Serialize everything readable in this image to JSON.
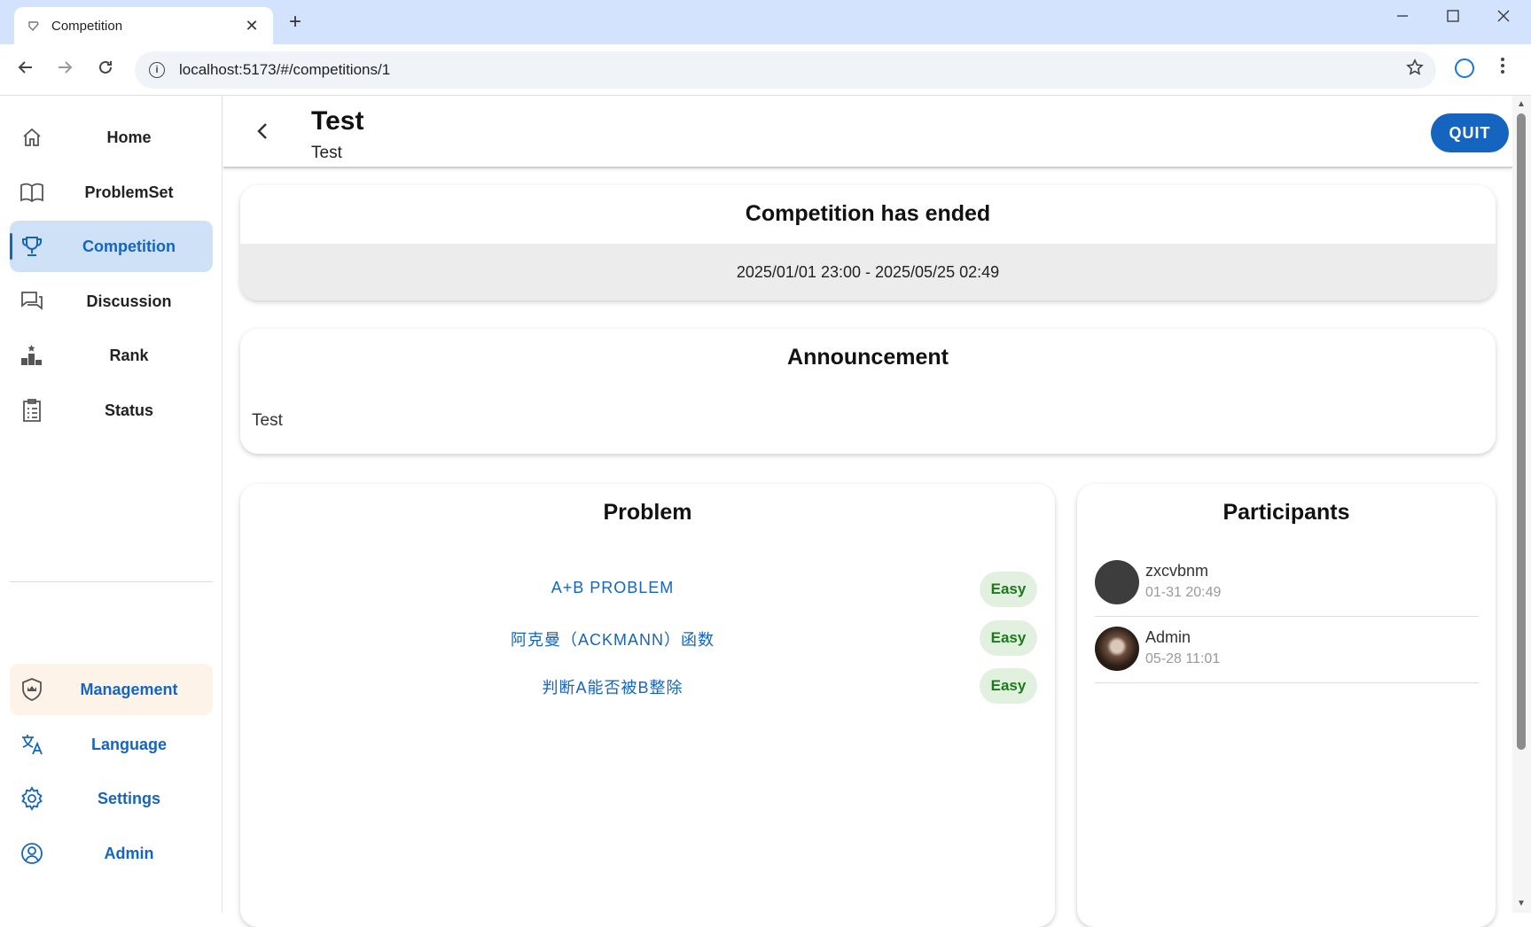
{
  "browser": {
    "tab_title": "Competition",
    "url": "localhost:5173/#/competitions/1",
    "new_tab": "+",
    "tab_close": "✕"
  },
  "sidebar": {
    "items": [
      {
        "label": "Home",
        "icon": "home-icon"
      },
      {
        "label": "ProblemSet",
        "icon": "book-icon"
      },
      {
        "label": "Competition",
        "icon": "trophy-icon",
        "active": true
      },
      {
        "label": "Discussion",
        "icon": "chat-icon"
      },
      {
        "label": "Rank",
        "icon": "rank-icon"
      },
      {
        "label": "Status",
        "icon": "clipboard-icon"
      }
    ],
    "bottom_items": [
      {
        "label": "Management",
        "icon": "shield-icon"
      },
      {
        "label": "Language",
        "icon": "translate-icon"
      },
      {
        "label": "Settings",
        "icon": "gear-icon"
      },
      {
        "label": "Admin",
        "icon": "account-icon"
      }
    ]
  },
  "header": {
    "title": "Test",
    "subtitle": "Test",
    "quit_label": "QUIT"
  },
  "status": {
    "title": "Competition has ended",
    "time_range": "2025/01/01 23:00 - 2025/05/25 02:49"
  },
  "announcement": {
    "title": "Announcement",
    "text": "Test"
  },
  "problems": {
    "title": "Problem",
    "items": [
      {
        "name": "A+B PROBLEM",
        "difficulty": "Easy"
      },
      {
        "name": "阿克曼（ACKMANN）函数",
        "difficulty": "Easy"
      },
      {
        "name": "判断A能否被B整除",
        "difficulty": "Easy"
      }
    ]
  },
  "participants": {
    "title": "Participants",
    "items": [
      {
        "name": "zxcvbnm",
        "time": "01-31 20:49"
      },
      {
        "name": "Admin",
        "time": "05-28 11:01"
      }
    ]
  },
  "colors": {
    "accent": "#1565c0",
    "active_nav_bg": "#cfe1f6",
    "easy_bg": "#e2f0df",
    "easy_text": "#1b7a1b"
  }
}
